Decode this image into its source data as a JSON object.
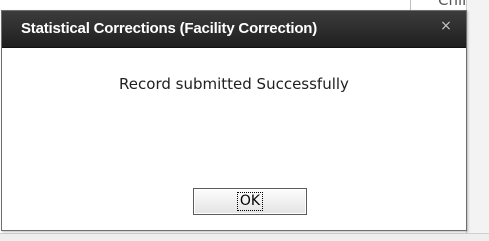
{
  "background": {
    "partial_text": "Chines"
  },
  "dialog": {
    "title": "Statistical Corrections (Facility Correction)",
    "close_glyph": "×",
    "message": "Record submitted Successfully",
    "ok_label": "OK"
  }
}
